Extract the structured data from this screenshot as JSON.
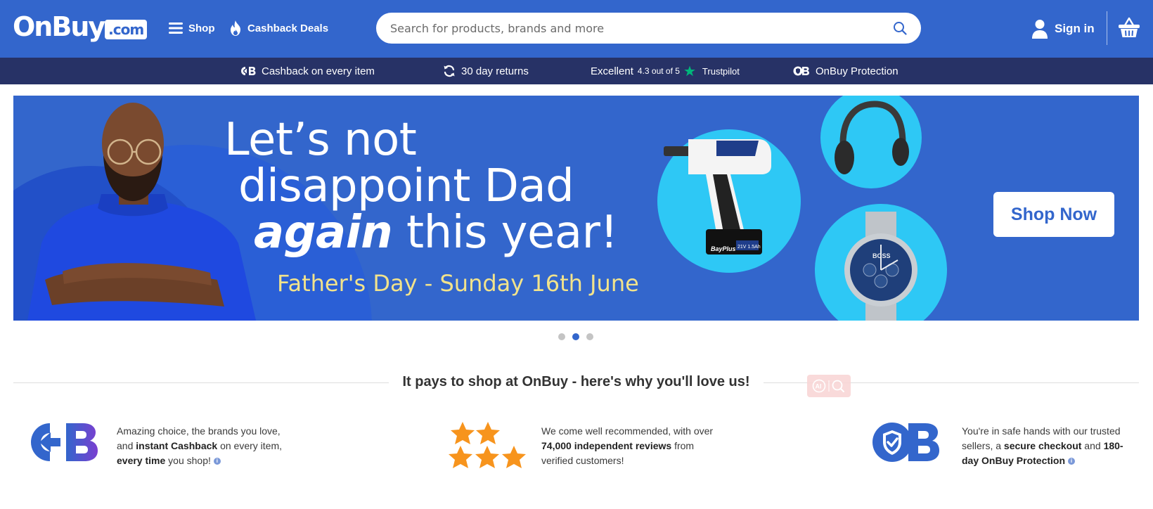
{
  "header": {
    "logo_main": "OnBuy",
    "logo_com": ".com",
    "nav_shop": "Shop",
    "nav_deals": "Cashback Deals",
    "search_placeholder": "Search for products, brands and more",
    "search_value": "",
    "signin_label": "Sign in",
    "brand_color": "#3366cc"
  },
  "usp_bar": {
    "cashback": "Cashback on every item",
    "returns": "30 day returns",
    "trustpilot_rating": "Excellent",
    "trustpilot_score": "4.3 out of 5",
    "trustpilot_brand": "Trustpilot",
    "protection": "OnBuy Protection",
    "background_color": "#273266"
  },
  "hero": {
    "line1": "Let’s not",
    "line2": "disappoint Dad",
    "line3_emphasis": "again",
    "line3_rest": " this year!",
    "subtitle": "Father's Day - Sunday 16th June",
    "drill_brand": "BayPlus",
    "drill_battery": "21V 1.5Ah",
    "watch_brand": "BOSS",
    "cta": "Shop Now",
    "accent_cyan": "#2ec8f5",
    "subtitle_color": "#f2e38b"
  },
  "carousel": {
    "slide_count": 3,
    "active_index": 1
  },
  "why": {
    "title": "It pays to shop at OnBuy - here's why you'll love us!",
    "features": [
      {
        "icon": "cashback-icon",
        "t1": "Amazing choice, the brands you love, and ",
        "b1": "instant Cashback",
        "t2": " on every item, ",
        "b2": "every time",
        "t3": " you shop!"
      },
      {
        "icon": "stars-icon",
        "t1": "We come well recommended, with over ",
        "b1": "74,000 independent reviews",
        "t2": " from verified customers!"
      },
      {
        "icon": "protection-shield-icon",
        "t1": "You're in safe hands with our trusted sellers, a ",
        "b1": "secure checkout",
        "t2": " and ",
        "b2": "180-day OnBuy Protection"
      }
    ],
    "star_color": "#f7941d"
  }
}
